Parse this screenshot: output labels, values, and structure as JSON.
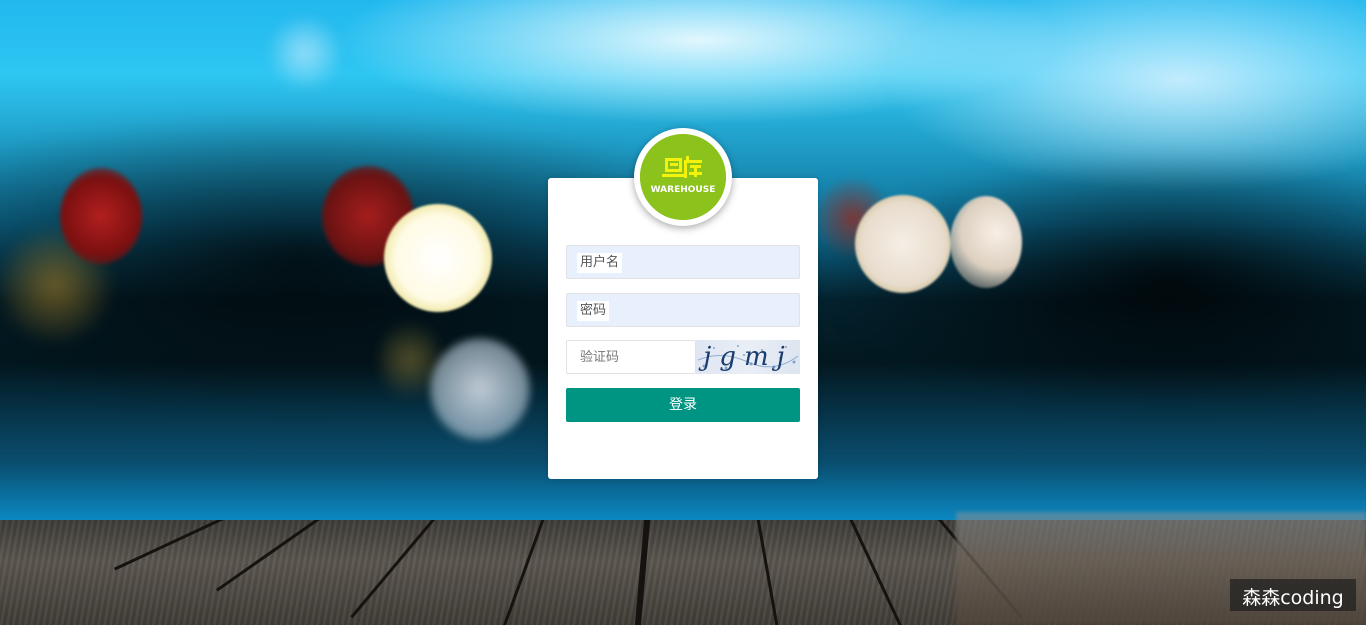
{
  "login": {
    "logo_text": "WAREHOUSE",
    "username_placeholder": "用户名",
    "password_placeholder": "密码",
    "captcha_placeholder": "验证码",
    "captcha_value": "jgmj",
    "submit_label": "登录"
  },
  "watermark": {
    "text": "森森coding"
  },
  "colors": {
    "button": "#009482",
    "logo_bg": "#8cc21c",
    "logo_text": "#f2f20c",
    "input_bg": "#e8f0fe"
  }
}
